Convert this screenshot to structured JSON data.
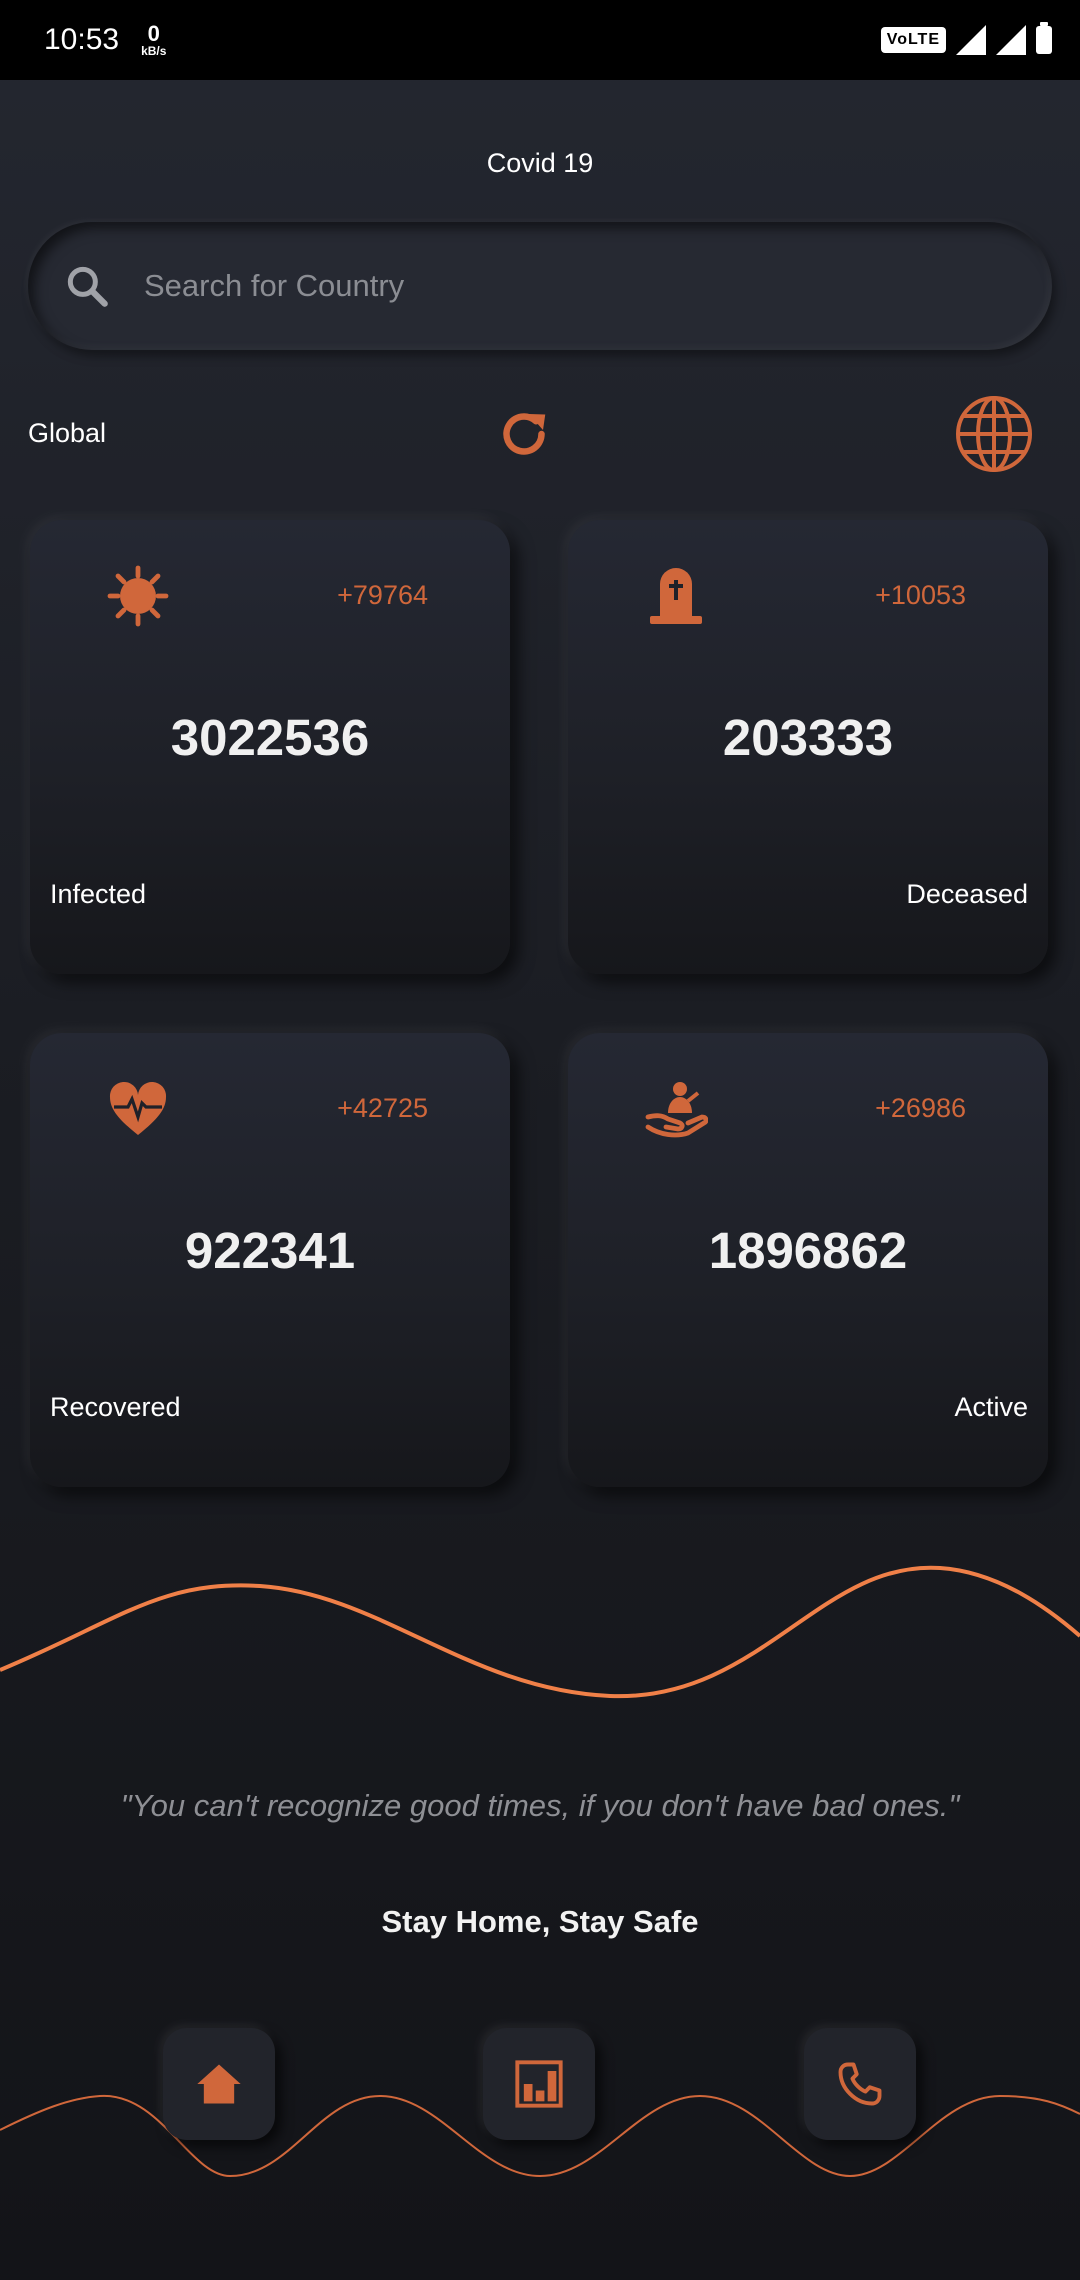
{
  "status_bar": {
    "time": "10:53",
    "net_speed": "0",
    "net_unit": "kB/s",
    "volte": "VoLTE"
  },
  "app": {
    "title": "Covid 19"
  },
  "search": {
    "placeholder": "Search for Country",
    "icon": "search-icon"
  },
  "scope": {
    "label": "Global",
    "refresh_icon": "refresh-icon",
    "globe_icon": "globe-icon"
  },
  "accent_color": "#d0673b",
  "stats": [
    {
      "label": "Infected",
      "value": "3022536",
      "delta": "+79764",
      "icon": "virus-icon"
    },
    {
      "label": "Deceased",
      "value": "203333",
      "delta": "+10053",
      "icon": "tombstone-icon"
    },
    {
      "label": "Recovered",
      "value": "922341",
      "delta": "+42725",
      "icon": "heartbeat-icon"
    },
    {
      "label": "Active",
      "value": "1896862",
      "delta": "+26986",
      "icon": "hand-care-icon"
    }
  ],
  "quote": "\"You can't recognize good times, if you don't have bad ones.\"",
  "slogan": "Stay Home, Stay Safe",
  "nav": [
    {
      "icon": "home-icon"
    },
    {
      "icon": "bar-chart-icon"
    },
    {
      "icon": "phone-icon"
    }
  ]
}
